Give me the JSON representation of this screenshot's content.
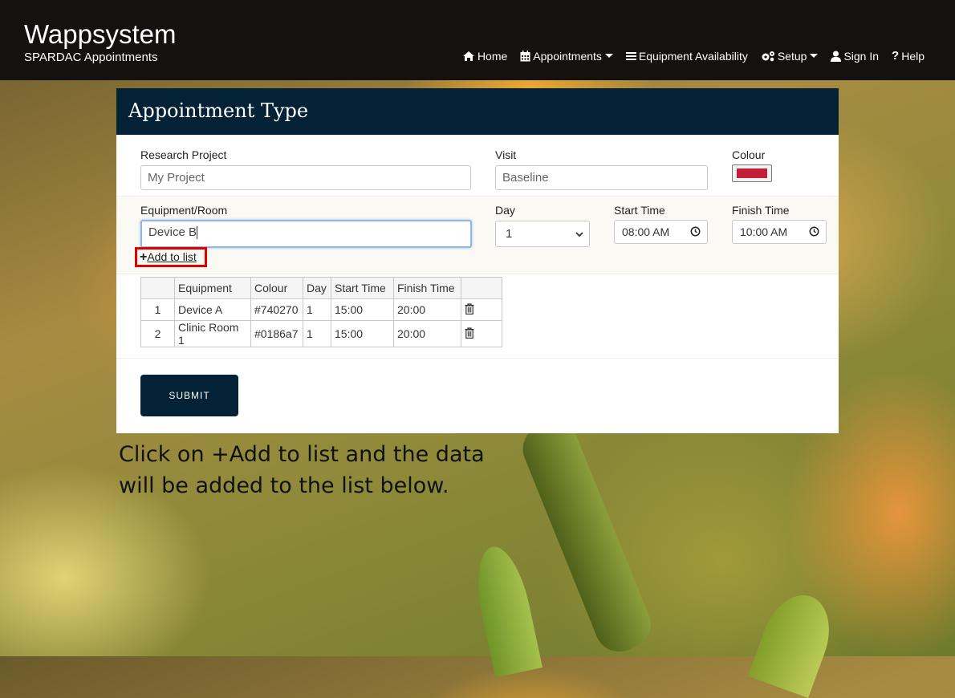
{
  "brand": {
    "title": "Wappsystem",
    "subtitle": "SPARDAC Appointments"
  },
  "nav": {
    "home": "Home",
    "appointments": "Appointments",
    "equipment_availability": "Equipment Availability",
    "setup": "Setup",
    "sign_in": "Sign In",
    "help": "Help"
  },
  "card": {
    "title": "Appointment Type",
    "research_project": {
      "label": "Research Project",
      "value": "My Project"
    },
    "visit": {
      "label": "Visit",
      "value": "Baseline"
    },
    "colour": {
      "label": "Colour",
      "value": "#c41f3a"
    },
    "equipment_room": {
      "label": "Equipment/Room",
      "value": "Device B"
    },
    "day": {
      "label": "Day",
      "value": "1"
    },
    "start_time": {
      "label": "Start Time",
      "value": "08:00 AM"
    },
    "finish_time": {
      "label": "Finish Time",
      "value": "10:00 AM"
    },
    "add_to_list": "Add to list",
    "submit": "SUBMIT"
  },
  "table": {
    "headers": [
      "",
      "Equipment",
      "Colour",
      "Day",
      "Start Time",
      "Finish Time",
      ""
    ],
    "rows": [
      {
        "num": "1",
        "equipment": "Device A",
        "colour": "#740270",
        "day": "1",
        "start": "15:00",
        "finish": "20:00"
      },
      {
        "num": "2",
        "equipment": "Clinic Room 1",
        "colour": "#0186a7",
        "day": "1",
        "start": "15:00",
        "finish": "20:00"
      }
    ]
  },
  "caption": "Click on +Add to list and the data will be added to the list below.",
  "colors": {
    "navbar": "#141111",
    "header": "#042235",
    "highlight": "#e00000"
  }
}
